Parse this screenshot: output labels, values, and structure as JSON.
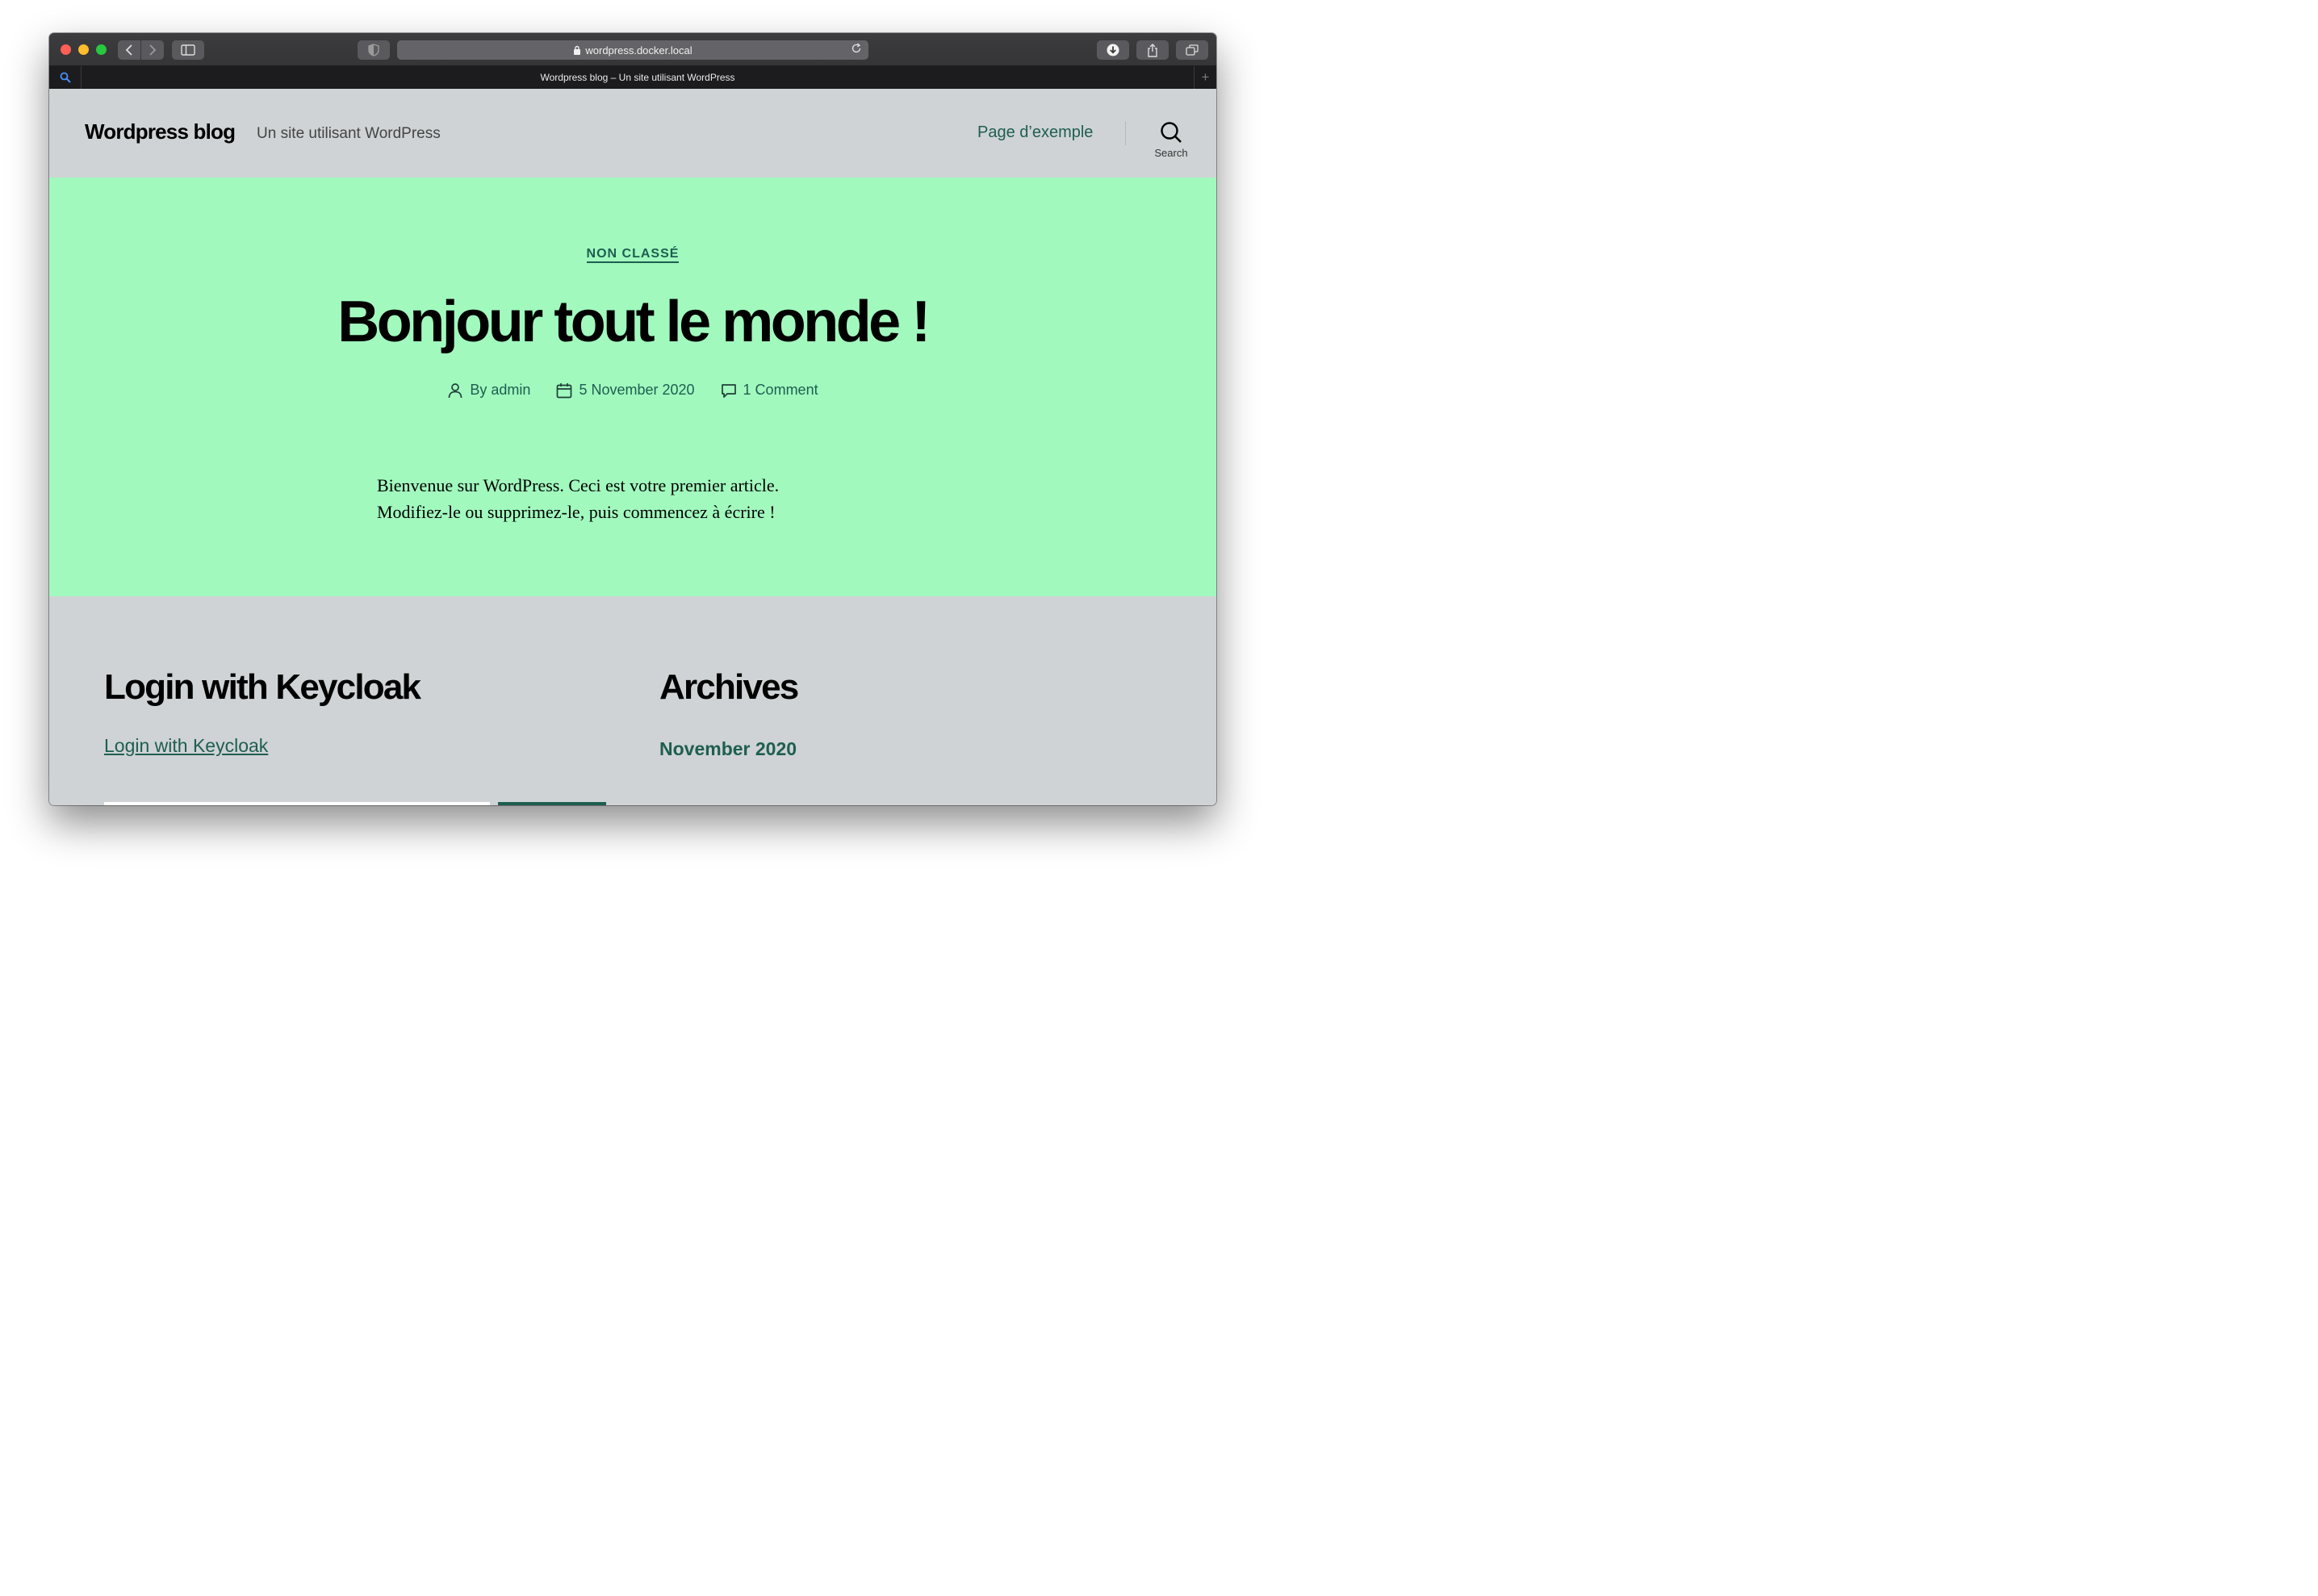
{
  "browser": {
    "url": "wordpress.docker.local",
    "tab_title": "Wordpress blog – Un site utilisant WordPress",
    "icons": [
      "close-icon",
      "minimize-icon",
      "maximize-icon",
      "back-icon",
      "forward-icon",
      "sidebar-icon",
      "shield-icon",
      "lock-icon",
      "reload-icon",
      "download-icon",
      "share-icon",
      "tabs-icon",
      "search-icon",
      "plus-icon"
    ]
  },
  "header": {
    "site_title": "Wordpress blog",
    "site_description": "Un site utilisant WordPress",
    "nav_link": "Page d’exemple",
    "search_label": "Search"
  },
  "post": {
    "category": "NON CLASSÉ",
    "title": "Bonjour tout le monde !",
    "author": "By admin",
    "date": "5 November 2020",
    "comments": "1 Comment",
    "body_line1": "Bienvenue sur WordPress. Ceci est votre premier article.",
    "body_line2": "Modifiez-le ou supprimez-le, puis commencez à écrire !"
  },
  "widgets": {
    "login_title": "Login with Keycloak",
    "login_link": "Login with Keycloak",
    "archives_title": "Archives",
    "archives_link": "November 2020"
  },
  "colors": {
    "hero_background": "#a1f9be",
    "page_background": "#cfd3d5",
    "accent": "#1e5e50"
  }
}
